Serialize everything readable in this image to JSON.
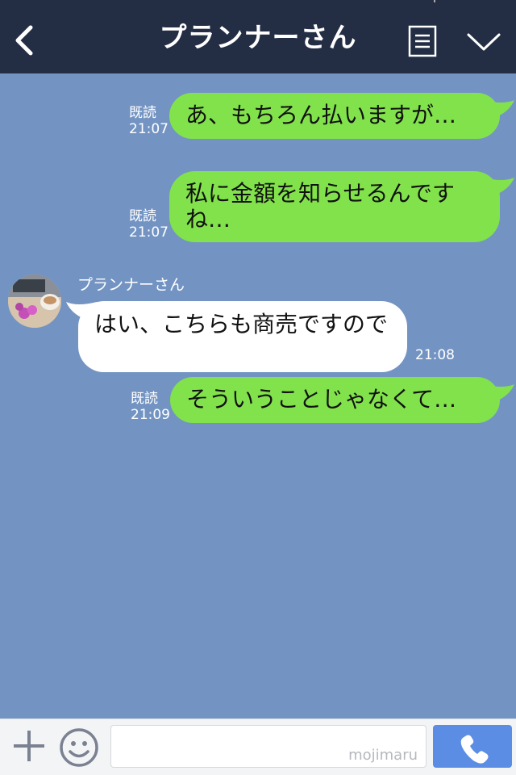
{
  "header": {
    "title": "プランナーさん",
    "back_icon": "chevron-left-icon",
    "menu_icon": "notes-icon",
    "expand_icon": "chevron-down-icon",
    "background": "#232d44"
  },
  "chat": {
    "background": "#7394c3",
    "messages": [
      {
        "from": "me",
        "text": "あ、もちろん払いますが…",
        "read": "既読",
        "time": "21:07"
      },
      {
        "from": "me",
        "text": "私に金額を知らせるんですね…",
        "read": "既読",
        "time": "21:07"
      },
      {
        "from": "プランナーさん",
        "text": "はい、こちらも商売ですので",
        "time": "21:08"
      },
      {
        "from": "me",
        "text": "そういうことじゃなくて…",
        "read": "既読",
        "time": "21:09"
      }
    ],
    "sender_name": "プランナーさん",
    "my_bubble_color": "#82e24b",
    "their_bubble_color": "#ffffff"
  },
  "footer": {
    "plus_icon": "plus-icon",
    "emoji_icon": "smiley-icon",
    "input_value": "",
    "watermark": "mojimaru",
    "call_icon": "phone-icon",
    "call_color": "#5b8de4"
  }
}
